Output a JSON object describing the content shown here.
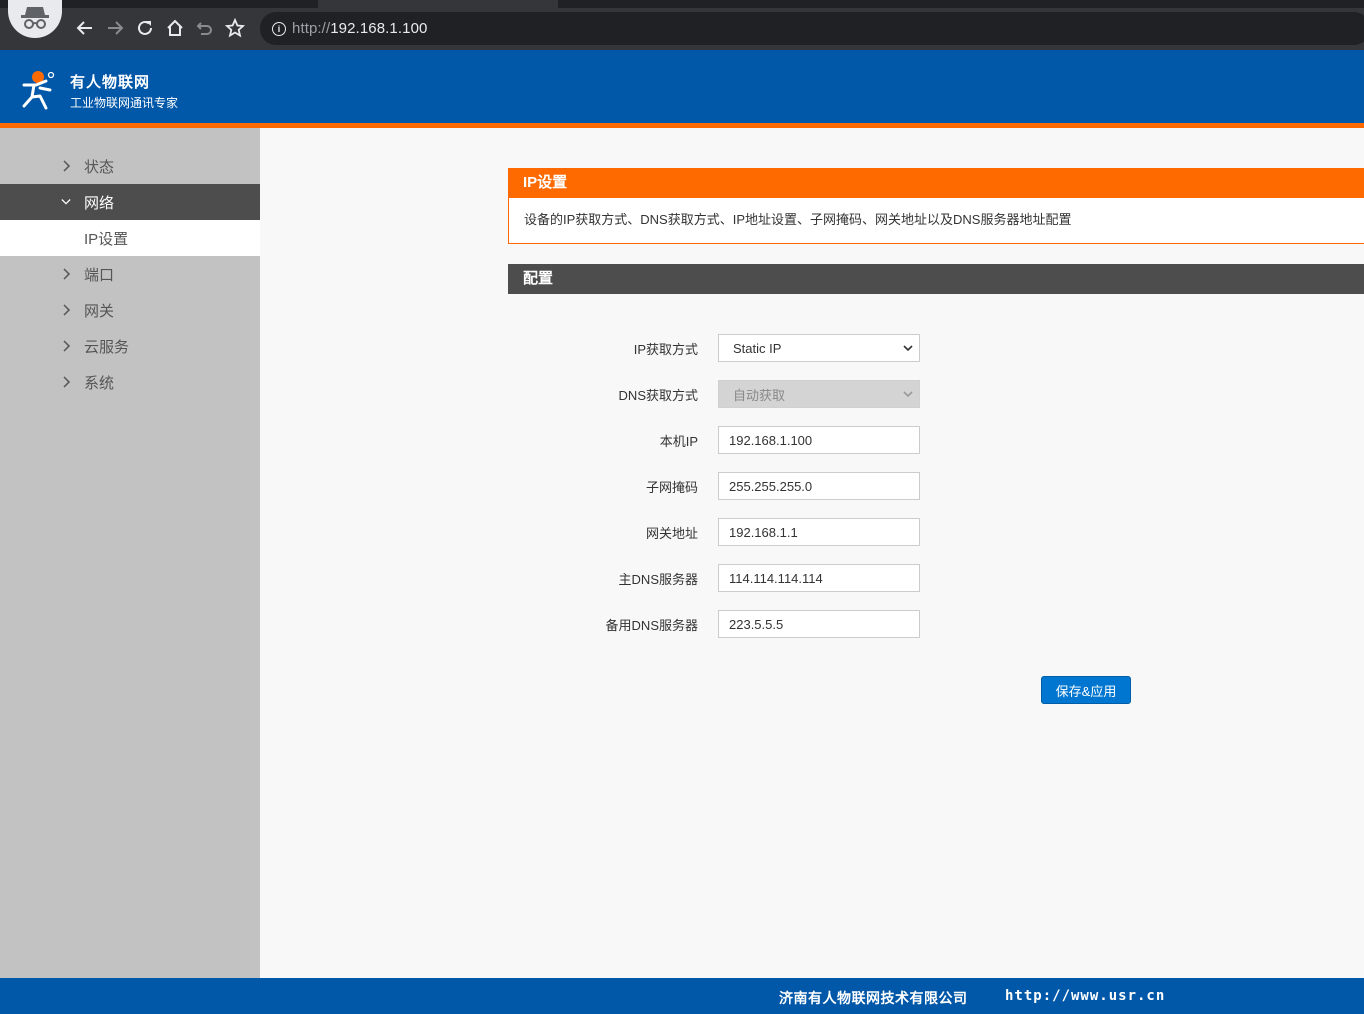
{
  "browser": {
    "url_scheme": "http://",
    "url_host": "192.168.1.100",
    "buttons": [
      "back-icon",
      "forward-icon",
      "reload-icon",
      "home-icon",
      "undo-icon",
      "bookmark-star-icon"
    ]
  },
  "header": {
    "brand_name": "有人物联网",
    "brand_sub": "工业物联网通讯专家"
  },
  "sidebar": {
    "items": [
      {
        "label": "状态"
      },
      {
        "label": "网络"
      },
      {
        "label": "端口"
      },
      {
        "label": "网关"
      },
      {
        "label": "云服务"
      },
      {
        "label": "系统"
      }
    ],
    "sub_item": "IP设置"
  },
  "panel": {
    "title": "IP设置",
    "description": "设备的IP获取方式、DNS获取方式、IP地址设置、子网掩码、网关地址以及DNS服务器地址配置"
  },
  "config": {
    "title": "配置",
    "fields": [
      {
        "label": "IP获取方式",
        "value": "Static IP"
      },
      {
        "label": "DNS获取方式",
        "value": "自动获取"
      },
      {
        "label": "本机IP",
        "value": "192.168.1.100"
      },
      {
        "label": "子网掩码",
        "value": "255.255.255.0"
      },
      {
        "label": "网关地址",
        "value": "192.168.1.1"
      },
      {
        "label": "主DNS服务器",
        "value": "114.114.114.114"
      },
      {
        "label": "备用DNS服务器",
        "value": "223.5.5.5"
      }
    ],
    "save_label": "保存&应用"
  },
  "footer": {
    "company": "济南有人物联网技术有限公司",
    "site": "http://www.usr.cn"
  },
  "colors": {
    "primary_blue": "#0157a8",
    "accent_orange": "#ff6a00",
    "dark_gray": "#4d4d4d",
    "button_blue": "#0076d1"
  }
}
